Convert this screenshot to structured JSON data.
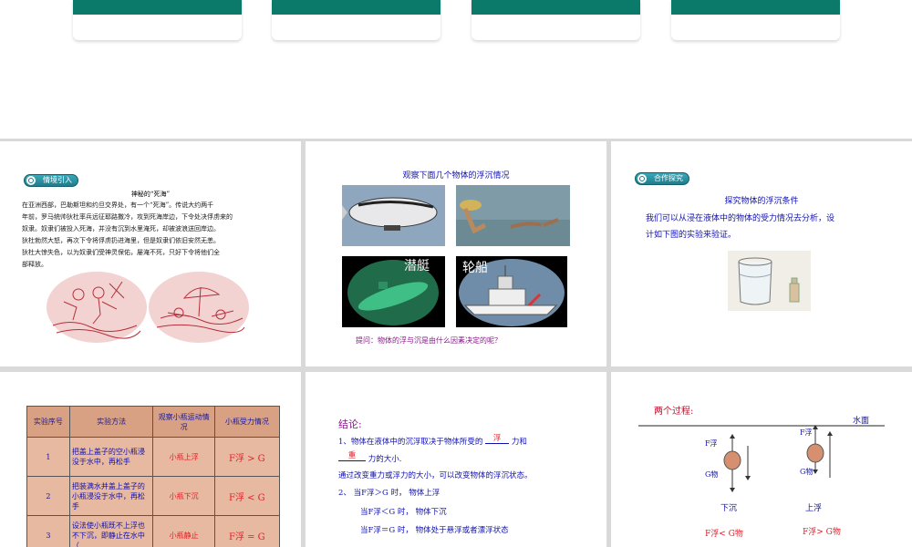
{
  "slide1": {
    "badge": "情境引入",
    "title": "神秘的“死海”",
    "lines": [
      "在亚洲西部，巴勒斯坦和约旦交界处，有一个“死海”。传说大约两千",
      "年前，罗马统帅狄杜率兵远征耶路撒冷，攻到死海岸边，下令处决俘虏来的",
      "奴隶。奴隶们被投入死海，并没有沉到水里淹死，却被波浪送回岸边。",
      "狄杜勃然大怒，再次下令将俘虏扔进海里，但是奴隶们依旧安然无恙。",
      "狄杜大惊失色，以为奴隶们受神灵保佑，屡淹不死，只好下令将他们全",
      "部释放。"
    ]
  },
  "slide2": {
    "title": "观察下面几个物体的浮沉情况",
    "label_sub": "潜艇",
    "label_ship": "轮船",
    "question": "提问：物体的浮与沉是由什么因素决定的呢？"
  },
  "slide3": {
    "badge": "合作探究",
    "title": "探究物体的浮沉条件",
    "body": [
      "我们可以从浸在液体中的物体的受力情况去分析，设",
      "计如下图的实验来验证。"
    ]
  },
  "slide4": {
    "headers": [
      "实验序号",
      "实验方法",
      "观察小瓶运动情况",
      "小瓶受力情况"
    ],
    "rows": [
      {
        "no": "1",
        "method": "把盖上盖子的空小瓶浸没于水中，再松手",
        "motion": "小瓶上浮",
        "force": "F浮 > G"
      },
      {
        "no": "2",
        "method": "把装满水并盖上盖子的小瓶浸没于水中，再松手",
        "motion": "小瓶下沉",
        "force": "F浮 < G"
      },
      {
        "no": "3",
        "method": "设法使小瓶既不上浮也不下沉，即静止在水中（",
        "motion": "小瓶静止",
        "force": "F浮 = G"
      }
    ]
  },
  "slide5": {
    "heading": "结论:",
    "line1a": "1、物体在液体中的沉浮取决于物体所受的",
    "blank1": "浮",
    "line1b": "力和",
    "blank2": "重",
    "line1c": "力的大小.",
    "line2": "通过改变重力或浮力的大小，可以改变物体的浮沉状态。",
    "line3": "2、  当F浮＞G   时，  物体上浮",
    "line4": "当F浮＜G   时，  物体下沉",
    "line5": "当F浮＝G   时，  物体处于悬浮或者漂浮状态"
  },
  "slide6": {
    "title": "两个过程:",
    "water": "水面",
    "f_label": "F浮",
    "g_label": "G物",
    "sink": "下沉",
    "rise": "上浮",
    "sink_cond": "F浮< G物",
    "rise_cond": "F浮> G物"
  },
  "colors": {
    "accent": "#0b7a6b",
    "text_blue": "#1010b0",
    "red": "#e0202a",
    "table_bg": "#e7b9a0"
  }
}
